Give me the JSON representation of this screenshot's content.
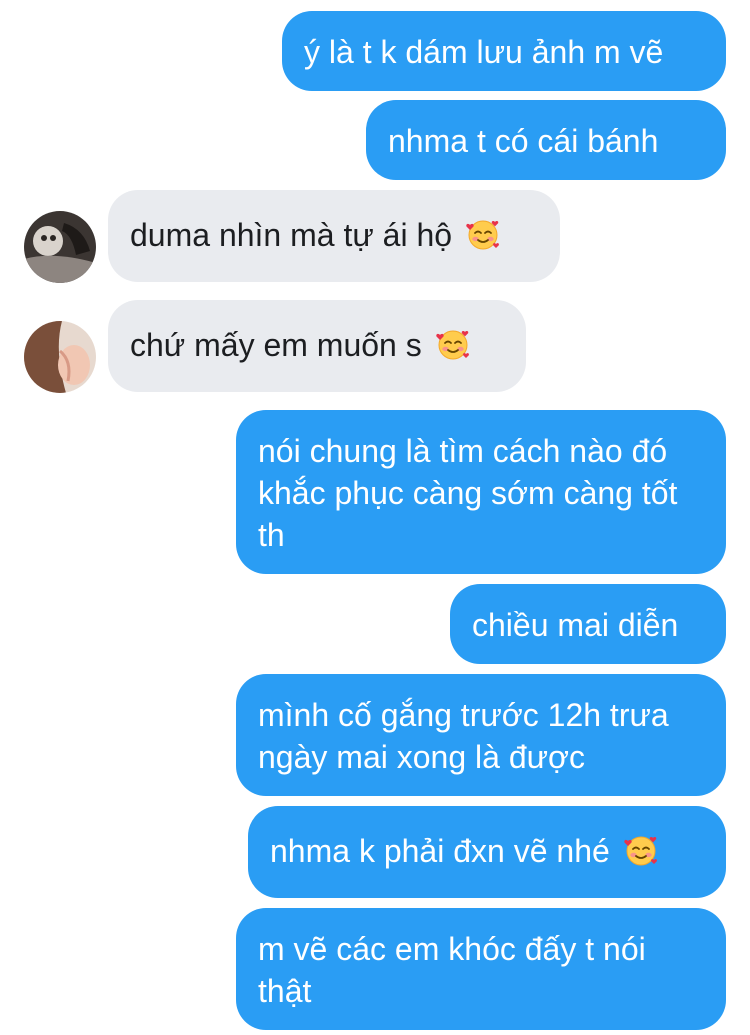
{
  "messages": [
    {
      "from": "me",
      "text": "ý là t k dám lưu ảnh m vẽ"
    },
    {
      "from": "me",
      "text": "nhma t có cái bánh"
    },
    {
      "from": "them",
      "text": "duma nhìn mà tự ái hộ",
      "emoji": "smiling-face-with-hearts-icon"
    },
    {
      "from": "them",
      "text": "chứ mấy em muốn s",
      "emoji": "smiling-face-with-hearts-icon"
    },
    {
      "from": "me",
      "text": "nói chung là tìm cách nào đó khắc phục càng sớm càng tốt th"
    },
    {
      "from": "me",
      "text": "chiều mai diễn"
    },
    {
      "from": "me",
      "text": "mình cố gắng trước 12h trưa ngày mai xong là được"
    },
    {
      "from": "me",
      "text": "nhma k phải đxn vẽ nhé",
      "emoji": "smiling-face-with-hearts-icon"
    },
    {
      "from": "me",
      "text": "m vẽ các em khóc đấy t nói thật"
    }
  ],
  "colors": {
    "sent_bubble": "#2a9df4",
    "received_bubble": "#e9ebef",
    "sent_text": "#ffffff",
    "received_text": "#1c1e21"
  }
}
